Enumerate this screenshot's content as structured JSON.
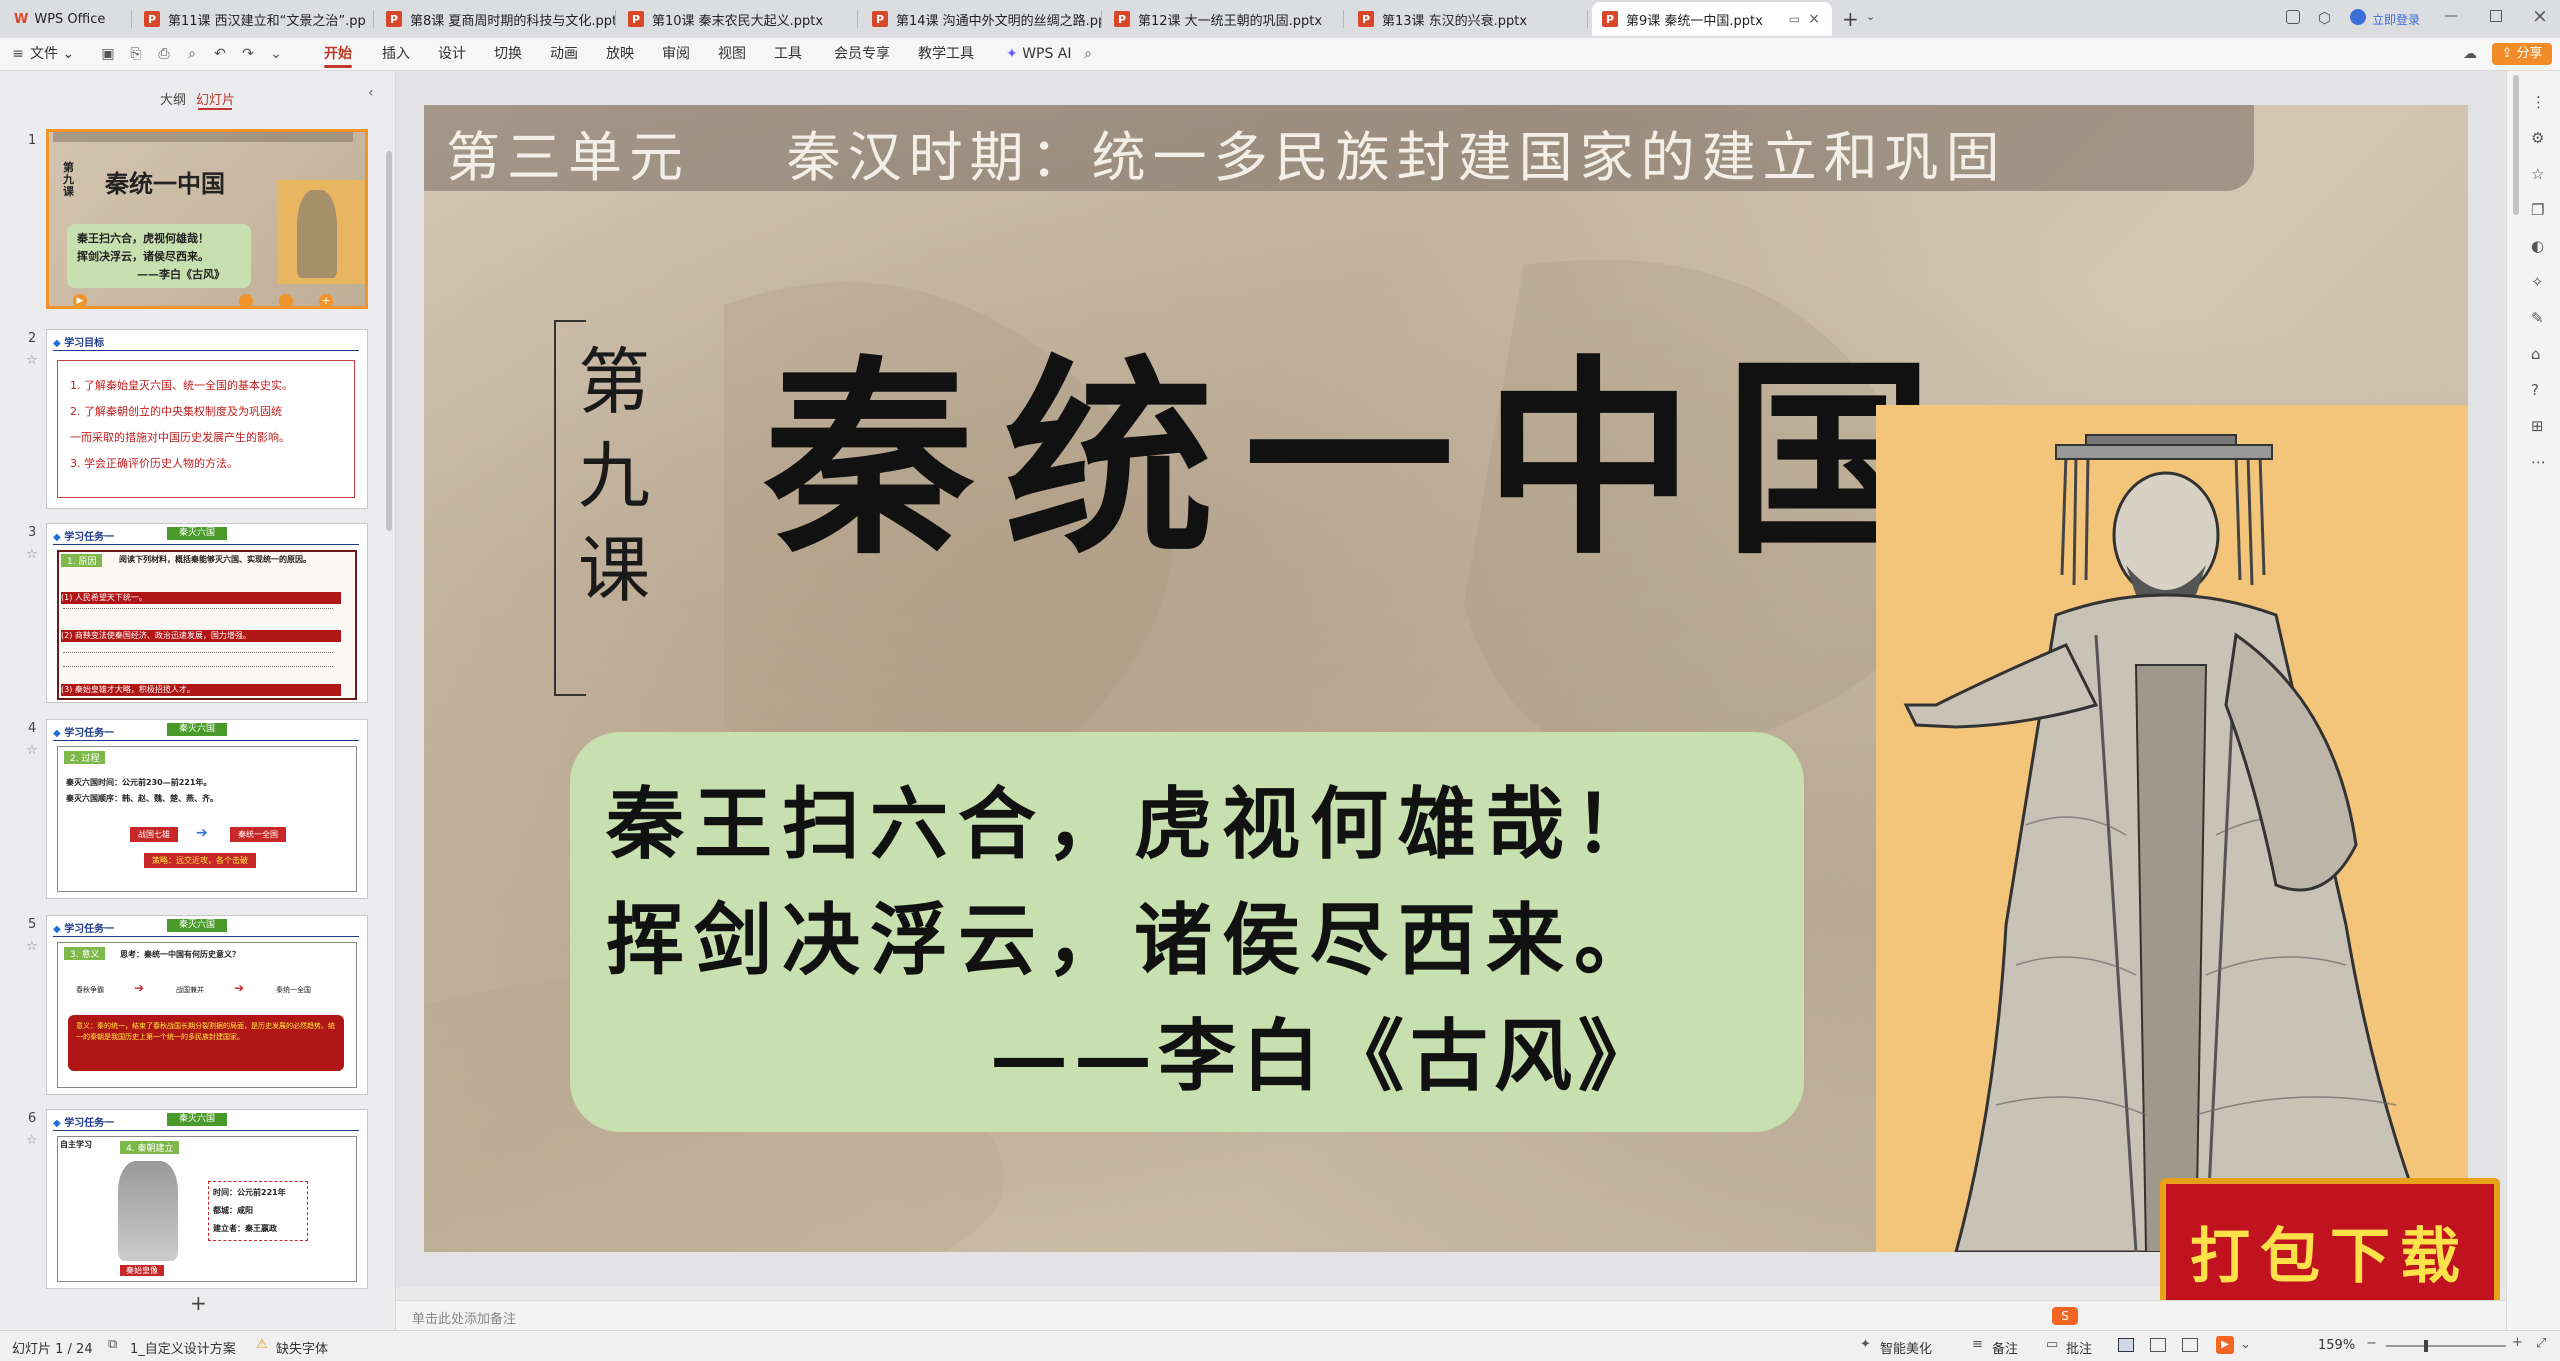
{
  "tabs": [
    {
      "label": "WPS Office",
      "type": "home"
    },
    {
      "label": "第11课  西汉建立和“文景之治”.pp",
      "type": "ppt"
    },
    {
      "label": "第8课  夏商周时期的科技与文化.pptx",
      "type": "ppt"
    },
    {
      "label": "第10课  秦末农民大起义.pptx",
      "type": "ppt"
    },
    {
      "label": "第14课  沟通中外文明的丝绸之路.pp",
      "type": "ppt"
    },
    {
      "label": "第12课  大一统王朝的巩固.pptx",
      "type": "ppt"
    },
    {
      "label": "第13课  东汉的兴衰.pptx",
      "type": "ppt"
    },
    {
      "label": "第9课  秦统一中国.pptx",
      "type": "ppt",
      "active": true
    }
  ],
  "tab_icon_letter": "P",
  "new_tab": "+",
  "login_label": "立即登录",
  "share_label": "分享",
  "menu": {
    "file": "文件",
    "items": [
      "开始",
      "插入",
      "设计",
      "切换",
      "动画",
      "放映",
      "审阅",
      "视图",
      "工具",
      "会员专享",
      "教学工具"
    ],
    "active": "开始",
    "wps_ai": "WPS AI"
  },
  "panel": {
    "tab_outline": "大纲",
    "tab_slides": "幻灯片",
    "add_slide": "+"
  },
  "thumbnails": [
    {
      "num": "1",
      "title": "秦统一中国",
      "poem": [
        "秦王扫六合，虎视何雄哉！",
        "挥剑决浮云，诸侯尽西来。",
        "——李白《古风》"
      ],
      "lesson": "第九课"
    },
    {
      "num": "2",
      "heading": "学习目标",
      "lines": [
        "1. 了解秦始皇灭六国、统一全国的基本史实。",
        "2. 了解秦朝创立的中央集权制度及为巩固统",
        "一而采取的措施对中国历史发展产生的影响。",
        "3. 学会正确评价历史人物的方法。"
      ]
    },
    {
      "num": "3",
      "heading": "学习任务一",
      "tag": "秦灭六国",
      "sub": "1. 原因",
      "lines": [
        "阅读下列材料，概括秦能够灭六国、实现统一的原因。",
        "(1) 人民希望天下统一。",
        "(2) 商鞅变法使秦国经济、政治迅速发展，国力增强。",
        "(3) 秦始皇雄才大略，积极招揽人才。"
      ]
    },
    {
      "num": "4",
      "heading": "学习任务一",
      "tag": "秦灭六国",
      "sub": "2. 过程",
      "lines": [
        "秦灭六国时间：公元前230—前221年。",
        "秦灭六国顺序：韩、赵、魏、楚、燕、齐。"
      ],
      "box_left": "战国七雄",
      "box_right": "秦统一全国",
      "strategy": "策略：远交近攻，各个击破"
    },
    {
      "num": "5",
      "heading": "学习任务一",
      "tag": "秦灭六国",
      "sub": "3. 意义",
      "question": "思考：秦统一中国有何历史意义？",
      "flow": [
        "春秋争霸",
        "战国兼并",
        "秦统一全国"
      ],
      "meaning": "意义：秦的统一，结束了春秋战国长期分裂割据的局面，是历史发展的必然趋势。统一的秦朝是我国历史上第一个统一的多民族封建国家。"
    },
    {
      "num": "6",
      "heading": "学习任务一",
      "tag": "秦灭六国",
      "sub": "4. 秦朝建立",
      "note": "自主学习",
      "caption": "秦始皇像",
      "facts": [
        "时间：公元前221年",
        "都城：咸阳",
        "建立者：秦王嬴政"
      ]
    }
  ],
  "slide": {
    "unit_banner": "第三单元    秦汉时期：统一多民族封建国家的建立和巩固",
    "lesson_number": "第九课",
    "title": "秦统一中国",
    "poem_line1": "秦王扫六合，虎视何雄哉！",
    "poem_line2": "挥剑决浮云，诸侯尽西来。",
    "poem_author": "——李白《古风》",
    "download_badge": "打包下载"
  },
  "notes_placeholder": "单击此处添加备注",
  "status": {
    "slide_info": "幻灯片 1 / 24",
    "theme": "1_自定义设计方案",
    "missing_font": "缺失字体",
    "smart_beautify": "智能美化",
    "notes": "备注",
    "comment": "批注",
    "zoom": "159%"
  },
  "colors": {
    "accent": "#c0392b",
    "thumb_sel": "#f0932b",
    "poem_box": "#c8dfb0",
    "badge": "#c1121f"
  }
}
